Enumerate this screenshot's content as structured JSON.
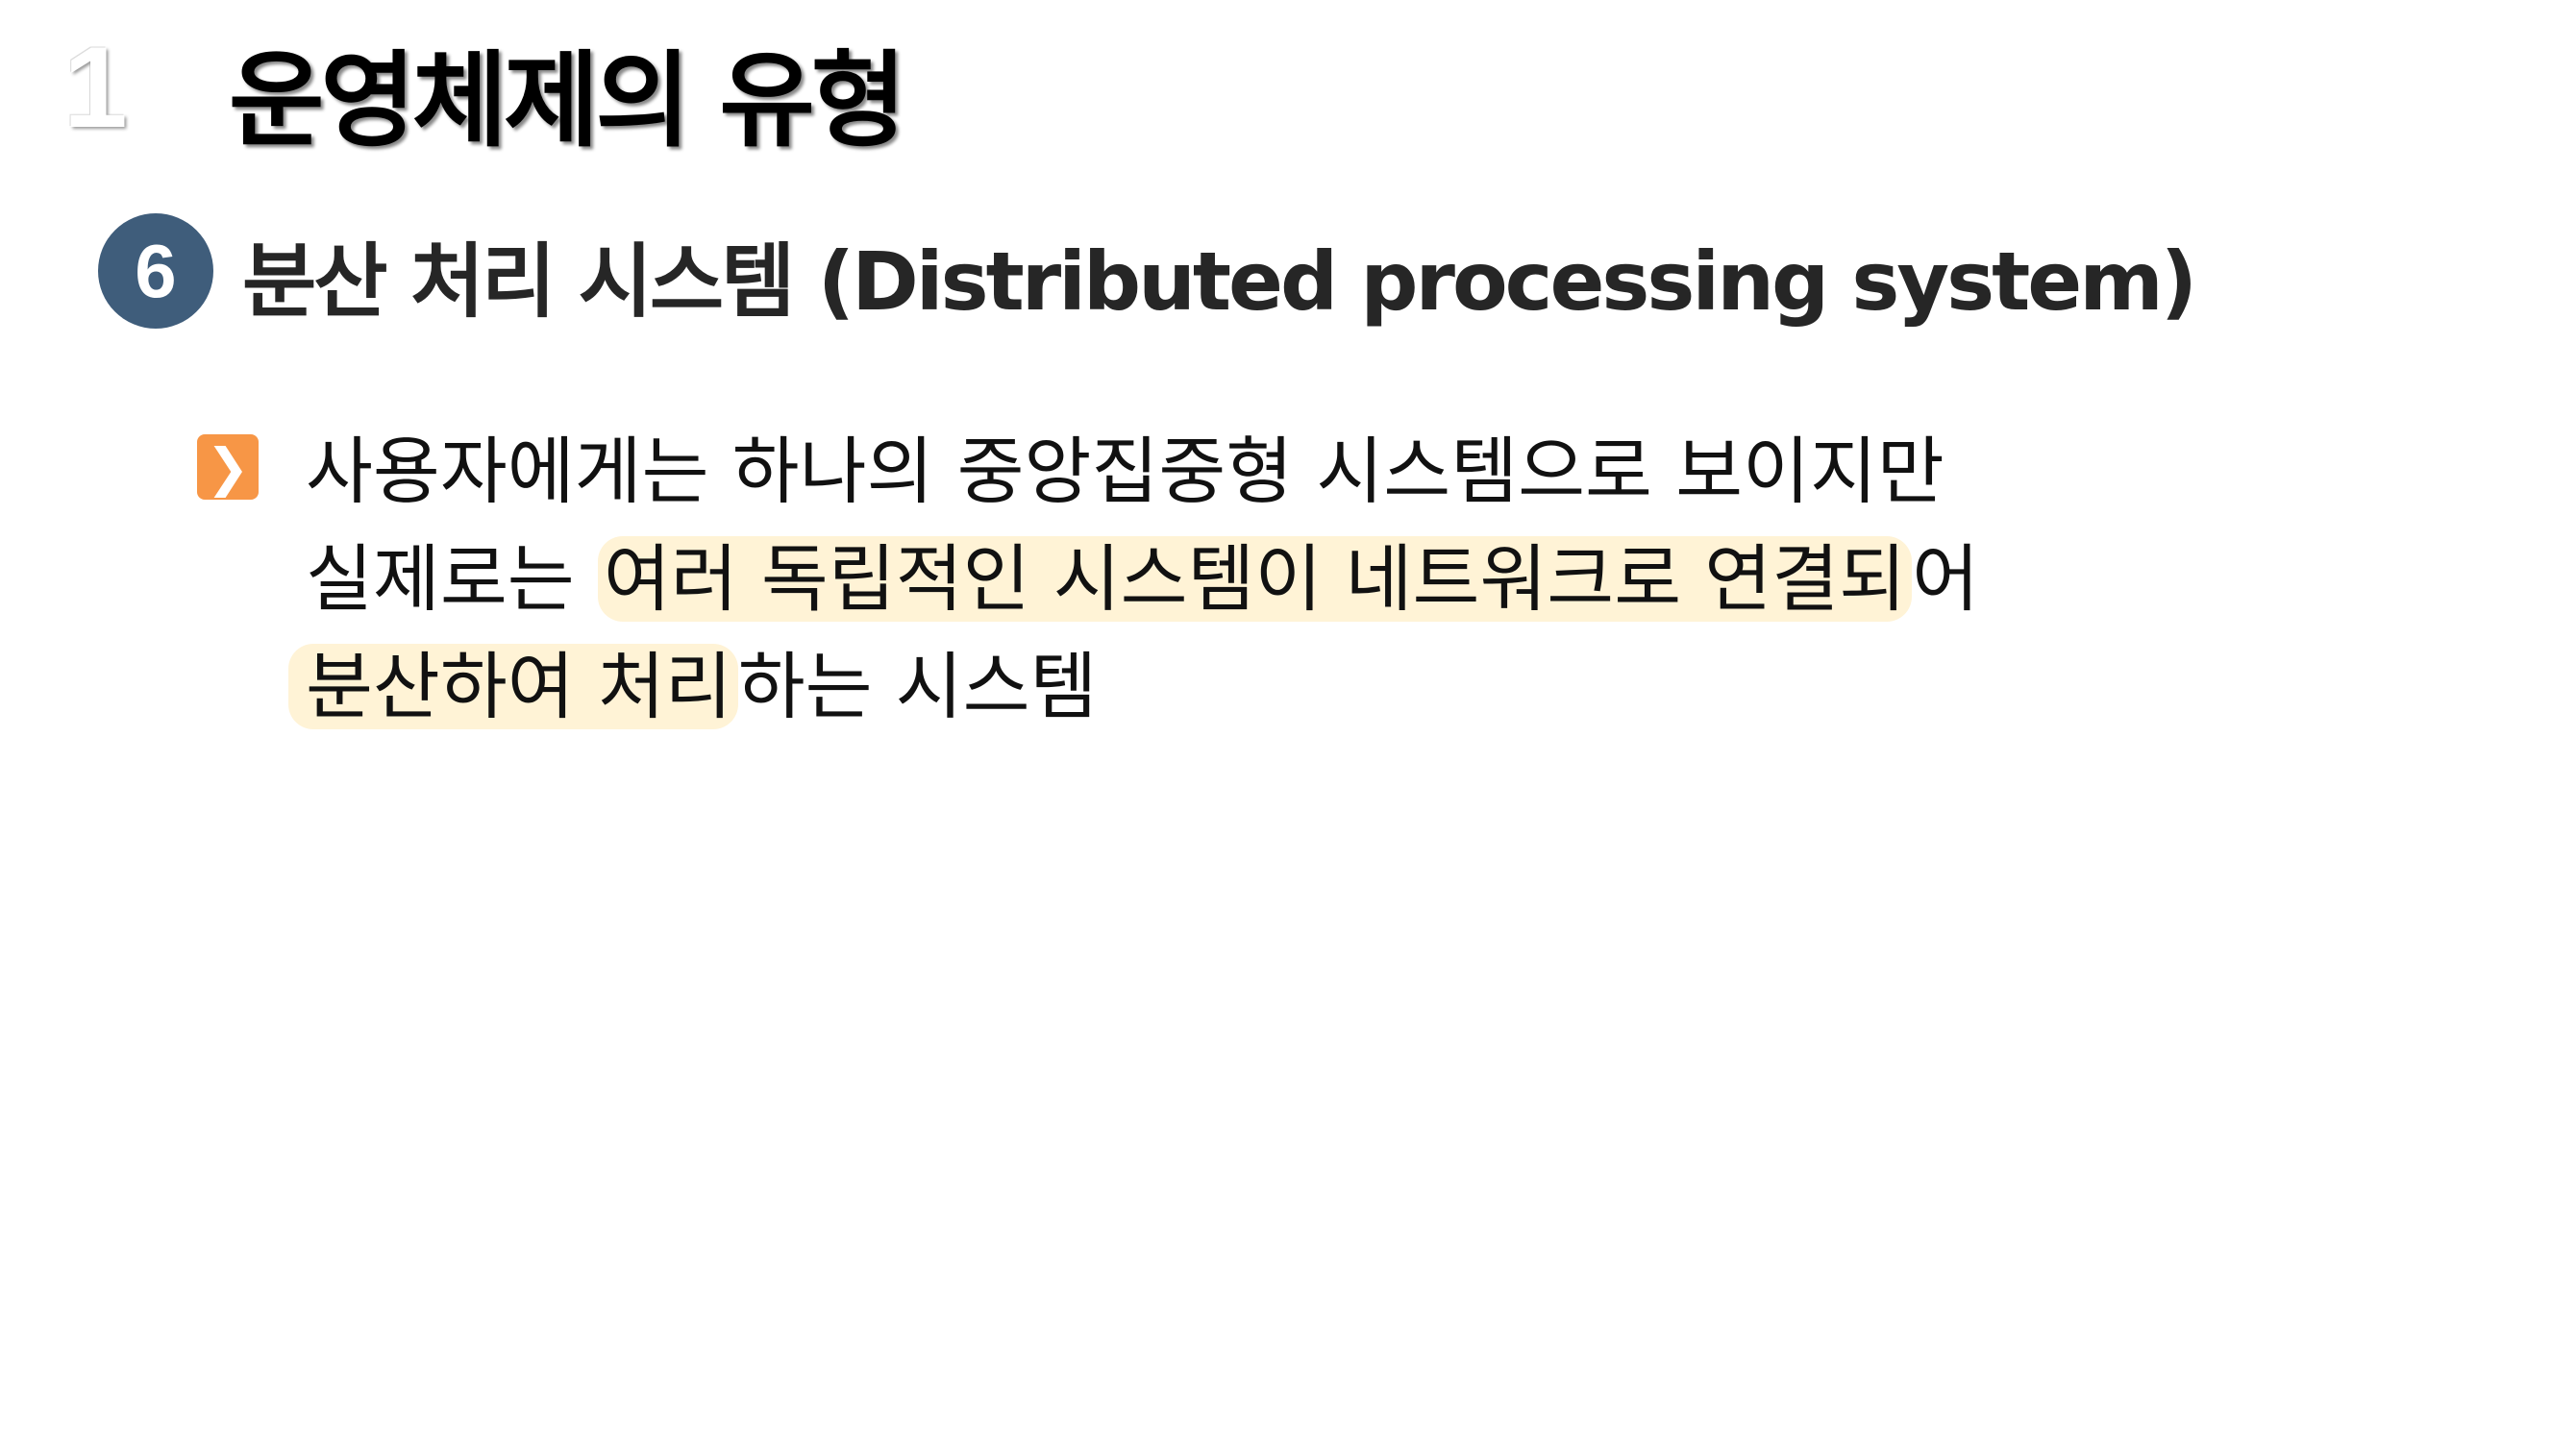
{
  "slide": {
    "section_number": "1",
    "title": "운영체제의 유형",
    "item_number": "6",
    "heading": "분산 처리 시스템 (Distributed processing system)",
    "bullet_icon": "chevron-right-icon",
    "accent_color": "#f79646",
    "badge_color": "#3f5d7b",
    "highlight_color": "#fff3d6",
    "body": {
      "line1": "사용자에게는 하나의 중앙집중형 시스템으로 보이지만",
      "line2_plain": "실제로는",
      "line2_highlight": "여러 독립적인 시스템이 네트워크로 연결되",
      "line2_tail": "어",
      "line3_highlight": "분산하여 처리",
      "line3_tail": "하는 시스템"
    }
  }
}
